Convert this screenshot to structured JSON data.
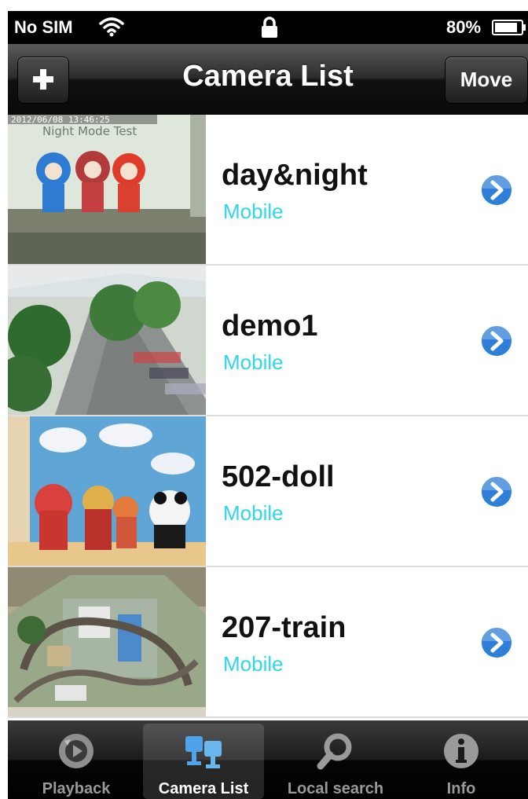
{
  "status_bar": {
    "carrier": "No SIM",
    "battery_percent": "80%",
    "icons": [
      "wifi-icon",
      "lock-icon",
      "battery-icon"
    ]
  },
  "navbar": {
    "title": "Camera List",
    "add_icon": "plus-icon",
    "move_label": "Move"
  },
  "cameras": [
    {
      "name": "day&night",
      "type": "Mobile",
      "thumb_overlay": "2012/06/08 13:46:25",
      "thumb_caption": "Night Mode Test"
    },
    {
      "name": "demo1",
      "type": "Mobile"
    },
    {
      "name": "502-doll",
      "type": "Mobile"
    },
    {
      "name": "207-train",
      "type": "Mobile"
    }
  ],
  "tabs": [
    {
      "label": "Playback",
      "icon": "playback-icon",
      "selected": false
    },
    {
      "label": "Camera List",
      "icon": "camera-list-icon",
      "selected": true
    },
    {
      "label": "Local search",
      "icon": "search-icon",
      "selected": false
    },
    {
      "label": "Info",
      "icon": "info-icon",
      "selected": false
    }
  ],
  "colors": {
    "subtitle": "#31d6e6",
    "disclosure_blue": "#2f7ed8",
    "navbar": "#1a1a1a"
  }
}
